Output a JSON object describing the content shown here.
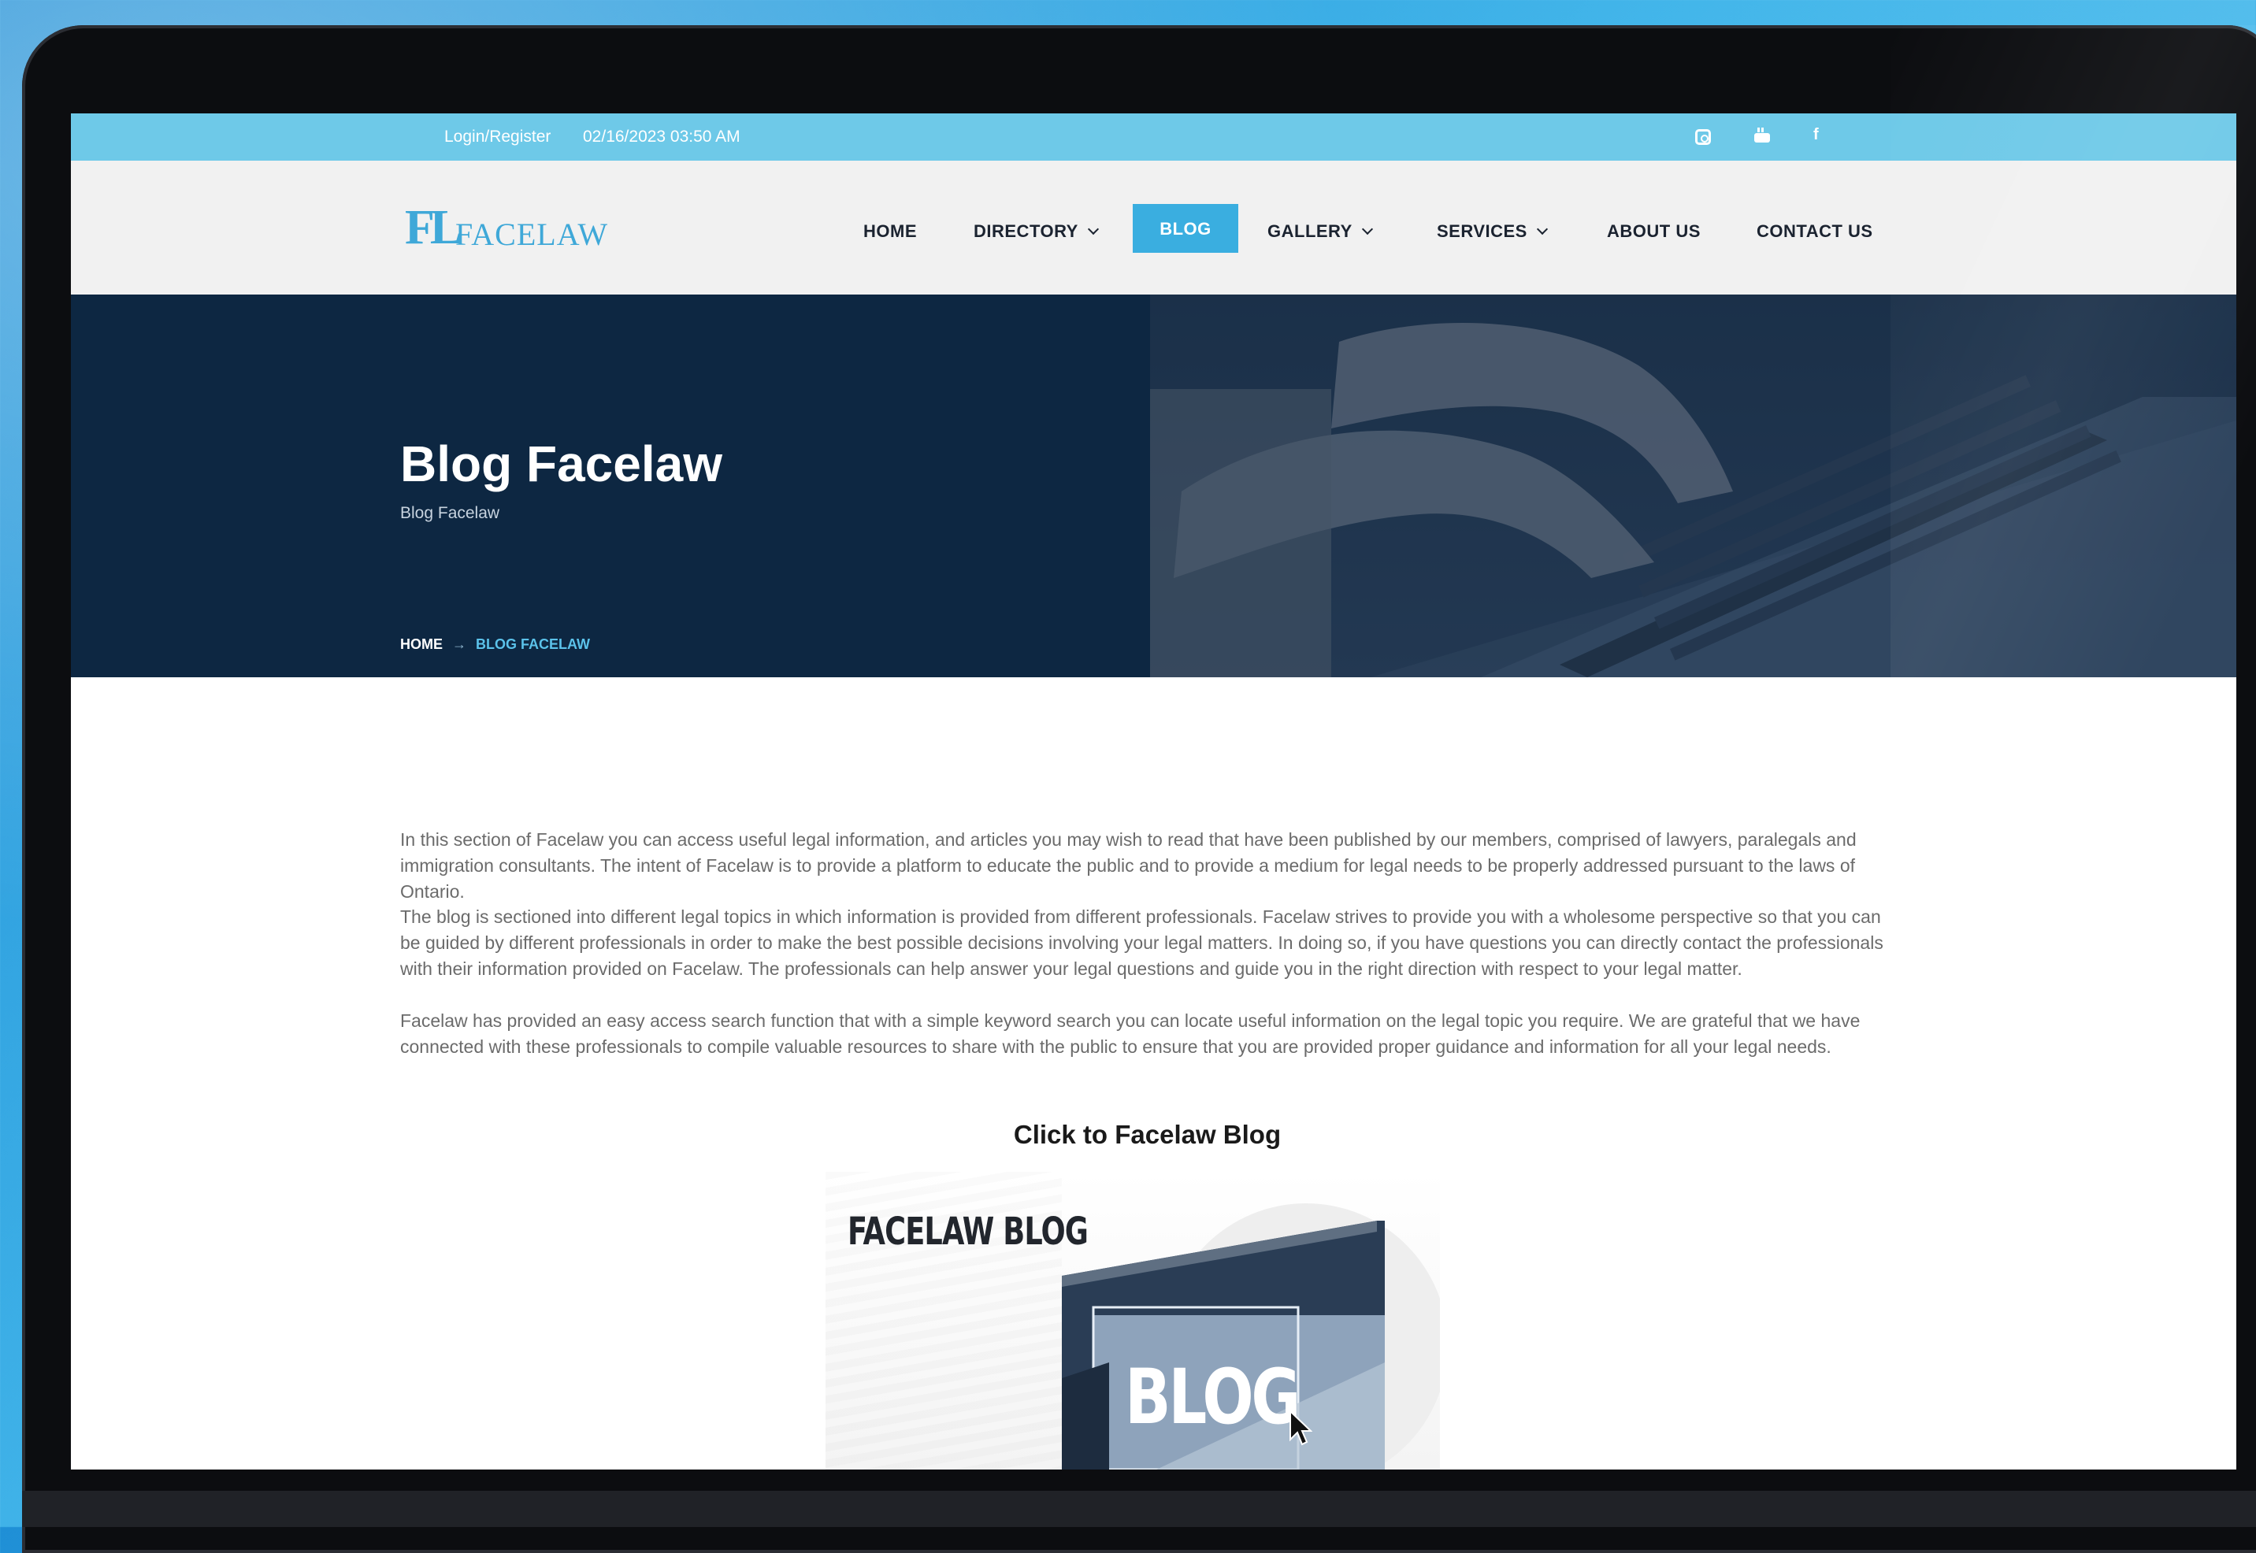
{
  "topbar": {
    "login_label": "Login/Register",
    "datetime": "02/16/2023 03:50 AM",
    "social_icons": [
      "instagram-icon",
      "youtube-icon",
      "facebook-icon"
    ],
    "facebook_glyph": "f"
  },
  "logo": {
    "mark": "FL",
    "text": "FACELAW"
  },
  "nav": {
    "home": "HOME",
    "directory": "DIRECTORY",
    "blog": "BLOG",
    "gallery": "GALLERY",
    "services": "SERVICES",
    "about": "ABOUT US",
    "contact": "CONTACT US",
    "active": "BLOG"
  },
  "hero": {
    "title": "Blog Facelaw",
    "subtitle": "Blog Facelaw",
    "breadcrumb_home": "HOME",
    "breadcrumb_arrow": "→",
    "breadcrumb_current": "BLOG FACELAW"
  },
  "content": {
    "paragraph_1": "In this section of Facelaw you can access useful legal information, and articles you may wish to read that have been published by our members, comprised of lawyers, paralegals and immigration consultants. The intent of Facelaw is to provide a platform to educate the public and to provide a medium for legal needs to be properly addressed pursuant to the laws of Ontario.",
    "paragraph_2": "The blog is sectioned into different legal topics in which information is provided from different professionals. Facelaw strives to provide you with a wholesome perspective so that you can be guided by different professionals in order to make the best possible decisions involving your legal matters. In doing so, if you have questions you can directly contact the professionals with their information provided on Facelaw. The professionals can help answer your legal questions and guide you in the right direction with respect to your legal matter.",
    "paragraph_3": "Facelaw has provided an easy access search function that with a simple keyword search you can locate useful information on the legal topic you require. We are grateful that we have connected with these professionals to compile valuable resources to share with the public to ensure that you are provided proper guidance and information for all your legal needs.",
    "cta": "Click to Facelaw Blog",
    "card_title": "FACELAW BLOG",
    "card_word": "BLOG"
  },
  "colors": {
    "topbar": "#6ec9e8",
    "accent": "#3aaee0",
    "hero_bg": "#0d2742",
    "header_bg": "#f1f1f1"
  }
}
